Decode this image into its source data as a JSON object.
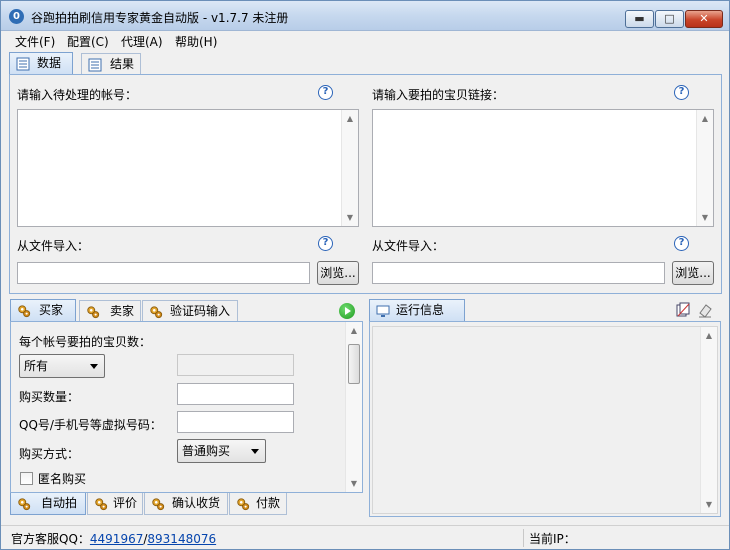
{
  "window": {
    "title": "谷跑拍拍刷信用专家黄金自动版 - v1.7.7 未注册",
    "min_glyph": "▬",
    "max_glyph": "□",
    "close_glyph": "✕"
  },
  "menu": [
    "文件(F)",
    "配置(C)",
    "代理(A)",
    "帮助(H)"
  ],
  "top_tabs": [
    {
      "label": "数据",
      "active": true
    },
    {
      "label": "结果",
      "active": false
    }
  ],
  "data_panel": {
    "accounts_label": "请输入待处理的帐号：",
    "links_label": "请输入要拍的宝贝链接：",
    "import_label_left": "从文件导入：",
    "import_label_right": "从文件导入：",
    "browse_left": "浏览...",
    "browse_right": "浏览...",
    "help_glyph": "?"
  },
  "buyer_tabs": [
    {
      "label": "买家",
      "active": true
    },
    {
      "label": "卖家",
      "active": false
    },
    {
      "label": "验证码输入",
      "active": false
    }
  ],
  "buyer_form": {
    "items_per_account_label": "每个帐号要拍的宝贝数：",
    "items_select_value": "所有",
    "quantity_label": "购买数量：",
    "qq_label": "QQ号/手机号等虚拟号码：",
    "buy_method_label": "购买方式：",
    "buy_method_value": "普通购买",
    "anonymous_label": "匿名购买"
  },
  "bottom_tabs": [
    {
      "label": "自动拍",
      "active": true
    },
    {
      "label": "评价",
      "active": false
    },
    {
      "label": "确认收货",
      "active": false
    },
    {
      "label": "付款",
      "active": false
    }
  ],
  "log_panel": {
    "title": "运行信息"
  },
  "status": {
    "support_prefix": "官方客服QQ：",
    "qq1": "4491967",
    "separator": "/",
    "qq2": "893148076",
    "current_ip_label": "当前IP："
  },
  "colors": {
    "accent": "#2b64b8",
    "panel_border": "#8fb0d8"
  }
}
